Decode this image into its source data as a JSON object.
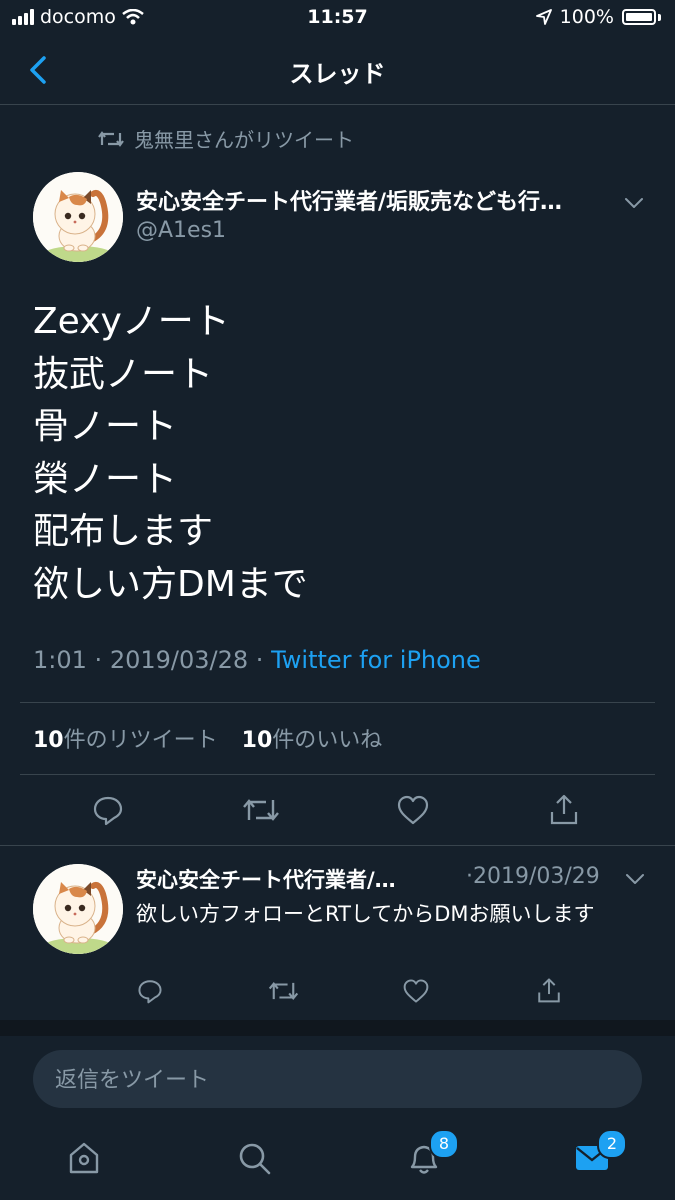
{
  "status_bar": {
    "carrier": "docomo",
    "time": "11:57",
    "battery": "100%"
  },
  "header": {
    "title": "スレッド"
  },
  "retweet_banner": "鬼無里さんがリツイート",
  "tweet": {
    "author_name": "安心安全チート代行業者/垢販売なども行…",
    "handle": "@A1es1",
    "lines": [
      "Zexyノート",
      "抜武ノート",
      "骨ノート",
      "榮ノート",
      "配布します",
      "欲しい方DMまで"
    ],
    "time": "1:01",
    "date": "2019/03/28",
    "separator": "·",
    "source": "Twitter for iPhone",
    "retweet_count": "10",
    "retweet_label": "件のリツイート",
    "like_count": "10",
    "like_label": "件のいいね"
  },
  "reply": {
    "author_name": "安心安全チート代行業者/…",
    "date": "·2019/03/29",
    "text": "欲しい方フォローとRTしてからDMお願いします"
  },
  "composer": {
    "placeholder": "返信をツイート"
  },
  "tabbar": {
    "notifications_badge": "8",
    "messages_badge": "2"
  },
  "colors": {
    "background": "#15202b",
    "accent": "#1da1f2",
    "muted": "#8899a6",
    "divider": "#38444d"
  },
  "icons": [
    "chevron-left-icon",
    "retweet-icon",
    "chevron-down-icon",
    "reply-icon",
    "like-icon",
    "share-icon",
    "home-icon",
    "search-icon",
    "bell-icon",
    "mail-icon",
    "location-arrow-icon",
    "wifi-icon"
  ]
}
